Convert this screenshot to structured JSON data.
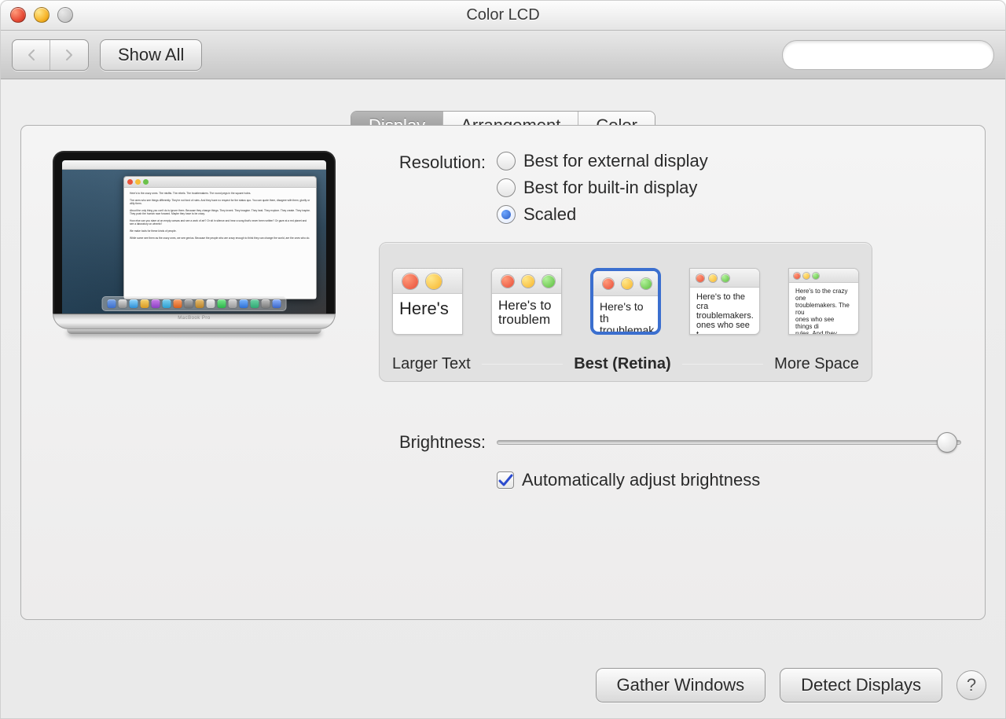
{
  "window": {
    "title": "Color LCD"
  },
  "toolbar": {
    "show_all": "Show All",
    "search_placeholder": ""
  },
  "tabs": {
    "display": "Display",
    "arrangement": "Arrangement",
    "color": "Color",
    "active": "display"
  },
  "resolution": {
    "label": "Resolution:",
    "options": {
      "best_external": "Best for external display",
      "best_builtin": "Best for built-in display",
      "scaled": "Scaled"
    },
    "selected": "scaled"
  },
  "scaled": {
    "labels": {
      "larger_text": "Larger Text",
      "best_retina": "Best (Retina)",
      "more_space": "More Space"
    },
    "sample_text": "Here's to the crazy ones. The misfits. The rebels. The troublemakers. The round pegs in the square holes. The ones who see things differently. They're not fond of rules. And they have no respect for the status quo. You can quote them, disagree with them, glorify or vilify them. About the only thing you can't do is ignore them. Because they change things.",
    "thumb_large": "Here's",
    "thumb_med": "Here's to\ntroublem",
    "thumb_sel": "Here's to th\ntroublemak\nones who s",
    "thumb_small": "Here's to the cra\ntroublemakers.\nones who see t\nrules. And they",
    "thumb_tiny": "Here's to the crazy one\ntroublemakers. The rou\nones who see things di\nrules. And they have no\ncan quote them, disagr\nthem. About the only th\nBecause they change th"
  },
  "brightness": {
    "label": "Brightness:",
    "value_percent": 97,
    "auto_label": "Automatically adjust brightness",
    "auto_checked": true
  },
  "preview": {
    "device": "MacBook Pro",
    "textedit_body": "Here's to the crazy ones. The misfits. The rebels. The troublemakers. The round pegs in the square holes.\n\nThe ones who see things differently. They're not fond of rules. And they have no respect for the status quo. You can quote them, disagree with them, glorify or vilify them.\n\nAbout the only thing you can't do is ignore them. Because they change things. They push the human race forward. And while some may see them as the crazy ones, we see genius.\n\nHow else can you stare at an empty canvas and see a work of art? Or sit in silence and hear a song that's never been written? Or gaze at a red planet and see a laboratory on wheels?\n\nWe make tools for these kinds of people.\n\nWhile some see them as the crazy ones, we see genius. Because the people who are crazy enough to think they can change the world, are the ones who do."
  },
  "footer": {
    "gather_windows": "Gather Windows",
    "detect_displays": "Detect Displays",
    "help": "?"
  }
}
